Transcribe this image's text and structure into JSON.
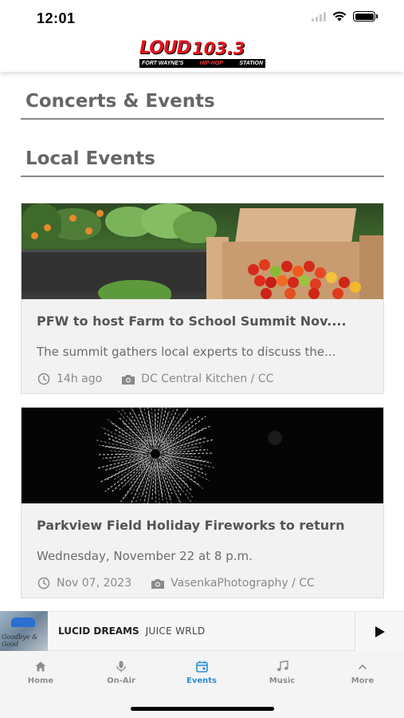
{
  "status_bar": {
    "time": "12:01"
  },
  "header": {
    "logo_word": "LOUD",
    "logo_frequency": "103.3",
    "logo_city": "FORT WAYNE'S",
    "logo_genre": "HIP-HOP",
    "logo_station": "STATION"
  },
  "sections": {
    "concerts_title": "Concerts & Events",
    "local_title": "Local Events"
  },
  "cards": [
    {
      "title": "PFW to host Farm to School Summit Nov....",
      "description": "The summit gathers local experts to discuss the...",
      "time": "14h ago",
      "credit": "DC Central Kitchen / CC"
    },
    {
      "title": "Parkview Field Holiday Fireworks to return",
      "description": "Wednesday, November 22 at 8 p.m.",
      "time": "Nov 07, 2023",
      "credit": "VasenkaPhotography / CC"
    }
  ],
  "now_playing": {
    "song": "LUCID DREAMS",
    "artist": "JUICE WRLD",
    "art_text": "Goodbye & Good"
  },
  "tabs": [
    {
      "label": "Home",
      "icon": "home-icon"
    },
    {
      "label": "On-Air",
      "icon": "microphone-icon"
    },
    {
      "label": "Events",
      "icon": "calendar-icon"
    },
    {
      "label": "Music",
      "icon": "music-note-icon"
    },
    {
      "label": "More",
      "icon": "chevron-up-icon"
    }
  ],
  "colors": {
    "accent": "#2b8fd6",
    "brand_red": "#e0141e",
    "section_title": "#666666",
    "card_bg": "#f2f2f2"
  }
}
